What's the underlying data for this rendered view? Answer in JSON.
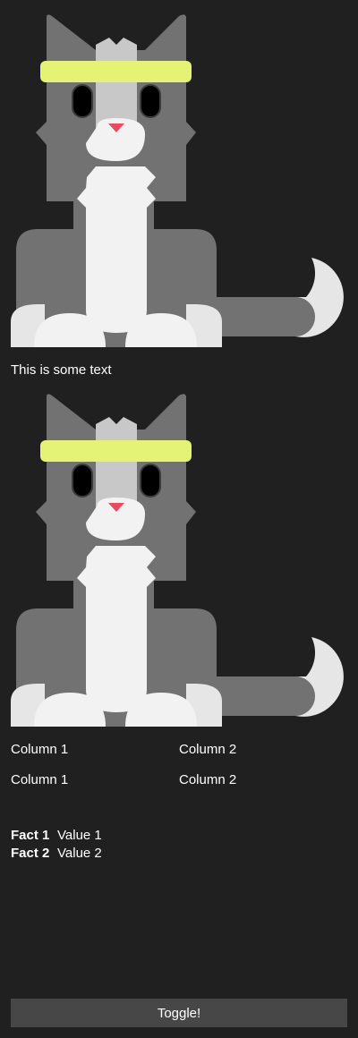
{
  "card": {
    "images": [
      {
        "alt": "cat illustration",
        "icon": "cat-image"
      },
      {
        "alt": "cat illustration",
        "icon": "cat-image"
      }
    ],
    "text_block": "This is some text",
    "column_sets": [
      {
        "columns": [
          "Column 1",
          "Column 2"
        ]
      },
      {
        "columns": [
          "Column 1",
          "Column 2"
        ]
      }
    ],
    "facts": [
      {
        "title": "Fact 1",
        "value": "Value 1"
      },
      {
        "title": "Fact 2",
        "value": "Value 2"
      }
    ],
    "toggle_label": "Toggle!"
  },
  "colors": {
    "background": "#202020",
    "cat_dark": "#727272",
    "cat_light": "#f2f2f2",
    "cat_mid": "#c8c8c8",
    "headband": "#e4f276",
    "nose": "#e84a5f",
    "button": "#474747"
  }
}
